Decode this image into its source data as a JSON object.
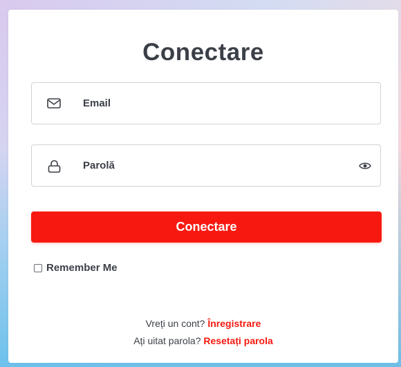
{
  "colors": {
    "accent": "#f7190f",
    "text": "#3b3f47",
    "border": "#cfd3d8"
  },
  "login": {
    "title": "Conectare",
    "email": {
      "icon": "mail-icon",
      "placeholder": "Email"
    },
    "password": {
      "icon": "lock-icon",
      "placeholder": "Parolă",
      "toggle_icon": "eye-icon"
    },
    "submit_label": "Conectare",
    "remember_label": "Remember Me",
    "register": {
      "prompt": "Vreți un cont?",
      "link": "Înregistrare"
    },
    "reset": {
      "prompt": "Ați uitat parola?",
      "link": "Resetați parola"
    }
  }
}
